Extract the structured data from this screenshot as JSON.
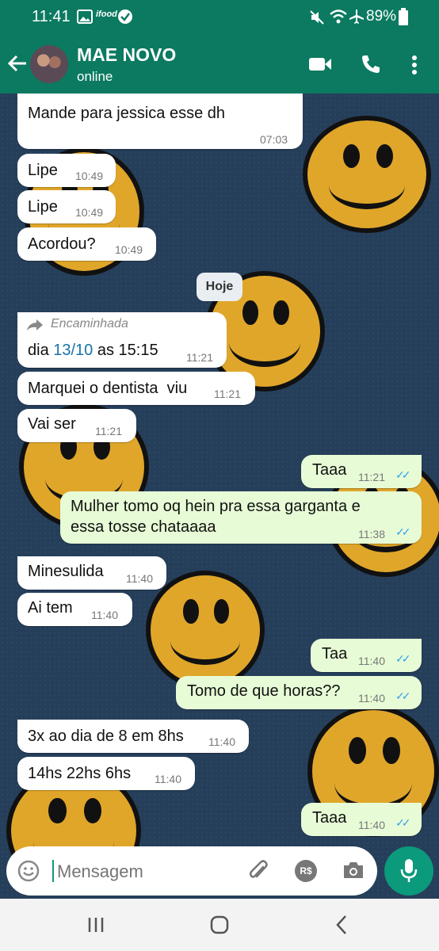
{
  "status_bar": {
    "time": "11:41",
    "battery": "89%",
    "app_badge": "ifood"
  },
  "header": {
    "contact_name": "MAE NOVO",
    "status": "online"
  },
  "chat": {
    "date_chip": "Hoje",
    "messages": [
      {
        "direction": "in",
        "text": "Mande para jessica esse dh",
        "time": "07:03"
      },
      {
        "direction": "in",
        "text": "Lipe",
        "time": "10:49"
      },
      {
        "direction": "in",
        "text": "Lipe",
        "time": "10:49"
      },
      {
        "direction": "in",
        "text": "Acordou?",
        "time": "10:49"
      },
      {
        "direction": "in",
        "forwarded_label": "Encaminhada",
        "text_before": "dia ",
        "date_link": "13/10",
        "text_after": " as 15:15",
        "time": "11:21"
      },
      {
        "direction": "in",
        "text": "Marquei o dentista  viu",
        "time": "11:21"
      },
      {
        "direction": "in",
        "text": "Vai ser",
        "time": "11:21"
      },
      {
        "direction": "out",
        "text": "Taaa",
        "time": "11:21"
      },
      {
        "direction": "out",
        "text_line1": "Mulher tomo oq hein pra essa garganta e",
        "text_line2": "essa tosse chataaaa",
        "time": "11:38"
      },
      {
        "direction": "in",
        "text": "Minesulida",
        "time": "11:40"
      },
      {
        "direction": "in",
        "text": "Ai tem",
        "time": "11:40"
      },
      {
        "direction": "out",
        "text": "Taa",
        "time": "11:40"
      },
      {
        "direction": "out",
        "text": "Tomo de que horas??",
        "time": "11:40"
      },
      {
        "direction": "in",
        "text": "3x ao dia de 8 em 8hs",
        "time": "11:40"
      },
      {
        "direction": "in",
        "text": "14hs 22hs 6hs",
        "time": "11:40"
      },
      {
        "direction": "out",
        "text": "Taaa",
        "time": "11:40"
      }
    ]
  },
  "composer": {
    "placeholder": "Mensagem",
    "payment_label": "R$"
  },
  "colors": {
    "header": "#0b7a60",
    "outgoing_bubble": "#e7fcd6",
    "incoming_bubble": "#ffffff",
    "read_ticks": "#36a2eb",
    "link": "#1a73a8",
    "mic_button": "#0b9a7b"
  }
}
